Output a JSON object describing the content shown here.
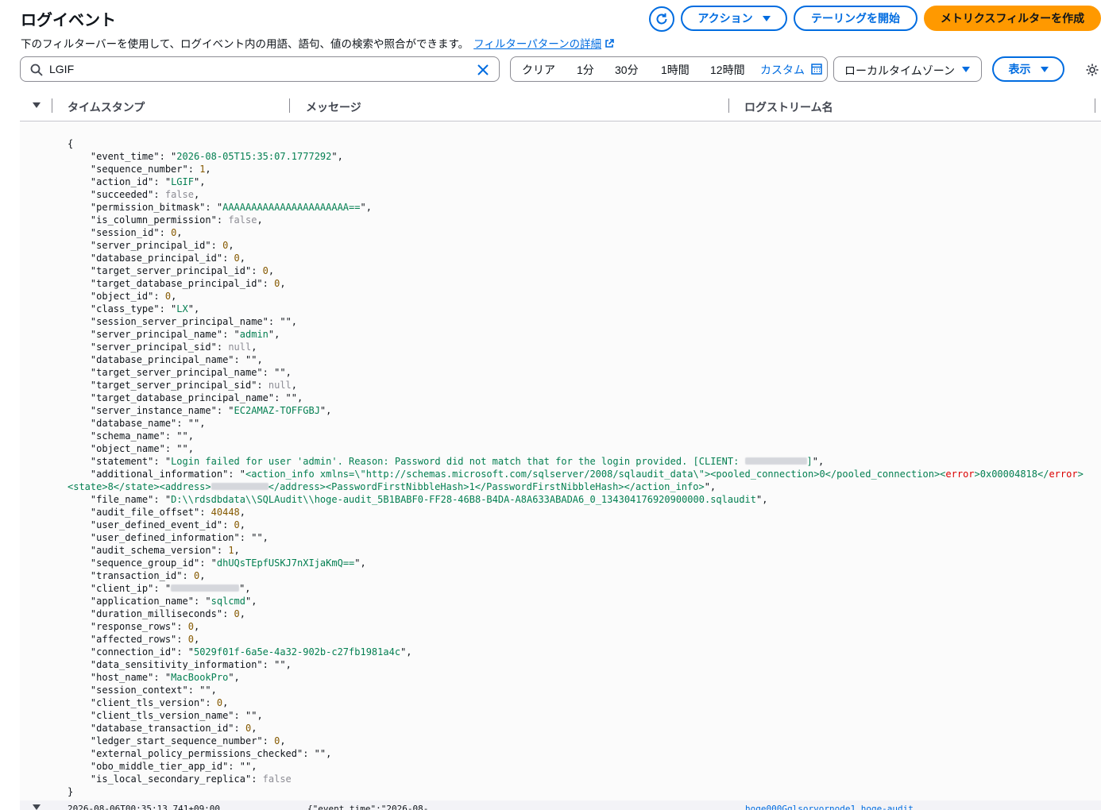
{
  "page": {
    "title": "ログイベント",
    "description": "下のフィルターバーを使用して、ログイベント内の用語、語句、値の検索や照合ができます。",
    "learn_more_link": "フィルターパターンの詳細"
  },
  "toolbar": {
    "actions_label": "アクション",
    "tail_label": "テーリングを開始",
    "create_metric_filter_label": "メトリクスフィルターを作成"
  },
  "search": {
    "value": "LGIF"
  },
  "time_range": {
    "clear": "クリア",
    "opt_1m": "1分",
    "opt_30m": "30分",
    "opt_1h": "1時間",
    "opt_12h": "12時間",
    "custom": "カスタム"
  },
  "timezone": {
    "selected": "ローカルタイムゾーン"
  },
  "display_label": "表示",
  "columns": {
    "timestamp": "タイムスタンプ",
    "message": "メッセージ",
    "log_stream": "ログストリーム名"
  },
  "log_event": {
    "event_time": "2026-08-05T15:35:07.1777292",
    "sequence_number": "1",
    "action_id": "LGIF",
    "succeeded": "false",
    "permission_bitmask": "AAAAAAAAAAAAAAAAAAAAAA==",
    "is_column_permission": "false",
    "session_id": "0",
    "server_principal_id": "0",
    "database_principal_id": "0",
    "target_server_principal_id": "0",
    "target_database_principal_id": "0",
    "object_id": "0",
    "class_type": "LX",
    "session_server_principal_name": "",
    "server_principal_name": "admin",
    "server_principal_sid": "null",
    "database_principal_name": "",
    "target_server_principal_name": "",
    "target_server_principal_sid": "null",
    "target_database_principal_name": "",
    "server_instance_name": "EC2AMAZ-TOFFGBJ",
    "database_name": "",
    "schema_name": "",
    "object_name": "",
    "statement": "Login failed for user 'admin'. Reason: Password did not match that for the login provided. [CLIENT: ",
    "additional_information_part1": "<action_info xmlns=\\\"http://schemas.microsoft.com/sqlserver/2008/sqlaudit_data\\\"><pooled_connection>0</pooled_connection><",
    "additional_information_error_tag": "error",
    "additional_information_error_value": ">0x00004818</",
    "additional_information_part2": "<state>8</state><address>",
    "additional_information_part3": "</address><PasswordFirstNibbleHash>1</PasswordFirstNibbleHash></action_info>",
    "file_name": "D:\\\\rdsdbdata\\\\SQLAudit\\\\hoge-audit_5B1BABF0-FF28-46B8-B4DA-A8A633ABADA6_0_134304176920900000.sqlaudit",
    "audit_file_offset": "40448",
    "user_defined_event_id": "0",
    "user_defined_information": "",
    "audit_schema_version": "1",
    "sequence_group_id": "dhUQsTEpfUSKJ7nXIjaKmQ==",
    "transaction_id": "0",
    "application_name": "sqlcmd",
    "duration_milliseconds": "0",
    "response_rows": "0",
    "affected_rows": "0",
    "connection_id": "5029f01f-6a5e-4a32-902b-c27fb1981a4c",
    "data_sensitivity_information": "",
    "host_name": "MacBookPro",
    "session_context": "",
    "client_tls_version": "0",
    "client_tls_version_name": "",
    "database_transaction_id": "0",
    "ledger_start_sequence_number": "0",
    "external_policy_permissions_checked": "",
    "obo_middle_tier_app_id": "",
    "is_local_secondary_replica": "false"
  },
  "next_row": {
    "timestamp": "2026-08-06T00:35:13.741+09:00",
    "message": "{\"event_time\":\"2026-08-",
    "log_stream": "hoge000Gqlsorvornode1.hoge-audit"
  },
  "colors": {
    "accent": "#006ce0",
    "primary_button": "#ff9900",
    "string": "#037f51",
    "number": "#855900",
    "error_tag": "#db0000"
  }
}
